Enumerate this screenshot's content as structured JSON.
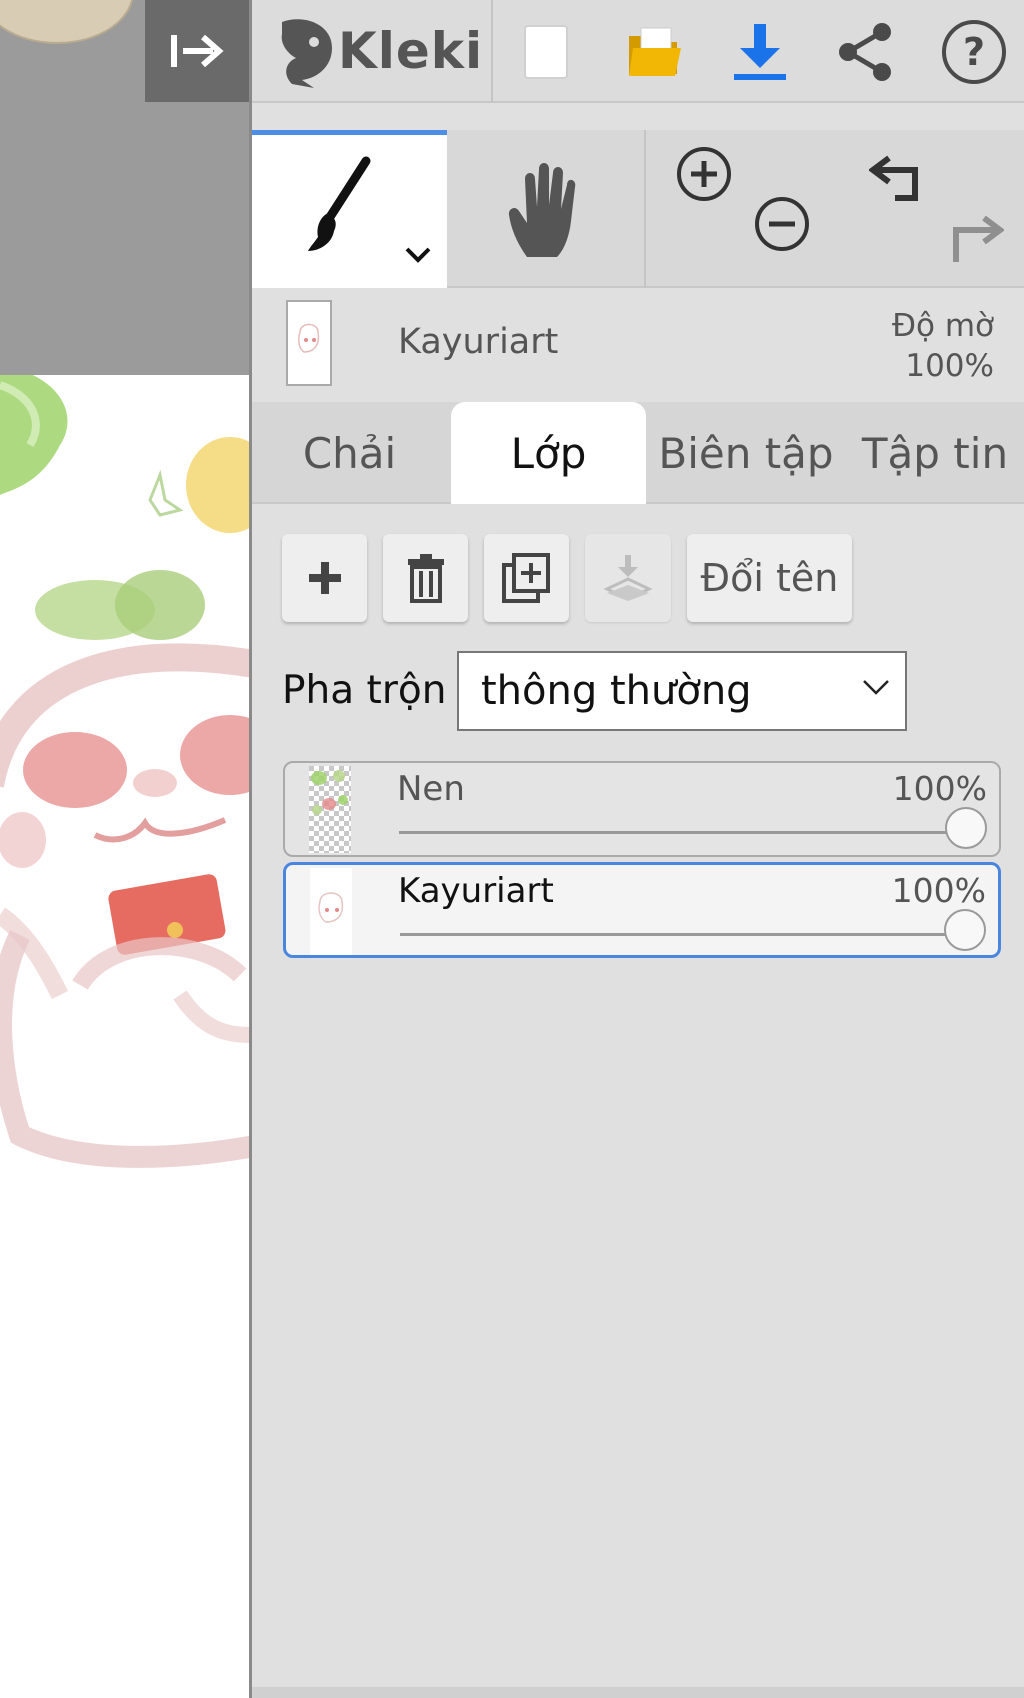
{
  "app": {
    "name": "Kleki"
  },
  "topbar": {
    "logo_text": "Kleki",
    "buttons": [
      {
        "name": "new-image",
        "icon": "blank-page-icon"
      },
      {
        "name": "open-file",
        "icon": "folder-icon"
      },
      {
        "name": "download",
        "icon": "download-icon"
      },
      {
        "name": "share",
        "icon": "share-icon"
      },
      {
        "name": "help",
        "icon": "help-icon"
      }
    ]
  },
  "tools": {
    "brush_icon": "brush-icon",
    "hand_icon": "hand-icon",
    "zoom_in_icon": "zoom-in-icon",
    "zoom_out_icon": "zoom-out-icon",
    "undo_icon": "undo-icon",
    "redo_icon": "redo-icon"
  },
  "layer_info": {
    "name": "Kayuriart",
    "opacity_label": "Độ mờ",
    "opacity_value": "100%"
  },
  "tabs": [
    {
      "label": "Chải",
      "active": false
    },
    {
      "label": "Lớp",
      "active": true
    },
    {
      "label": "Biên tập",
      "active": false
    },
    {
      "label": "Tập tin",
      "active": false
    }
  ],
  "layer_actions": {
    "add_icon": "plus-icon",
    "delete_icon": "trash-icon",
    "duplicate_icon": "duplicate-icon",
    "merge_icon": "merge-down-icon",
    "rename_label": "Đổi tên"
  },
  "blend": {
    "label": "Pha trộn",
    "value": "thông thường"
  },
  "layers": [
    {
      "name": "Nen",
      "opacity": "100%",
      "opacity_fraction": 1.0,
      "selected": false
    },
    {
      "name": "Kayuriart",
      "opacity": "100%",
      "opacity_fraction": 1.0,
      "selected": true
    }
  ],
  "colors": {
    "accent": "#4a86df",
    "download_blue": "#1a73e8",
    "folder_yellow": "#f2b705"
  }
}
